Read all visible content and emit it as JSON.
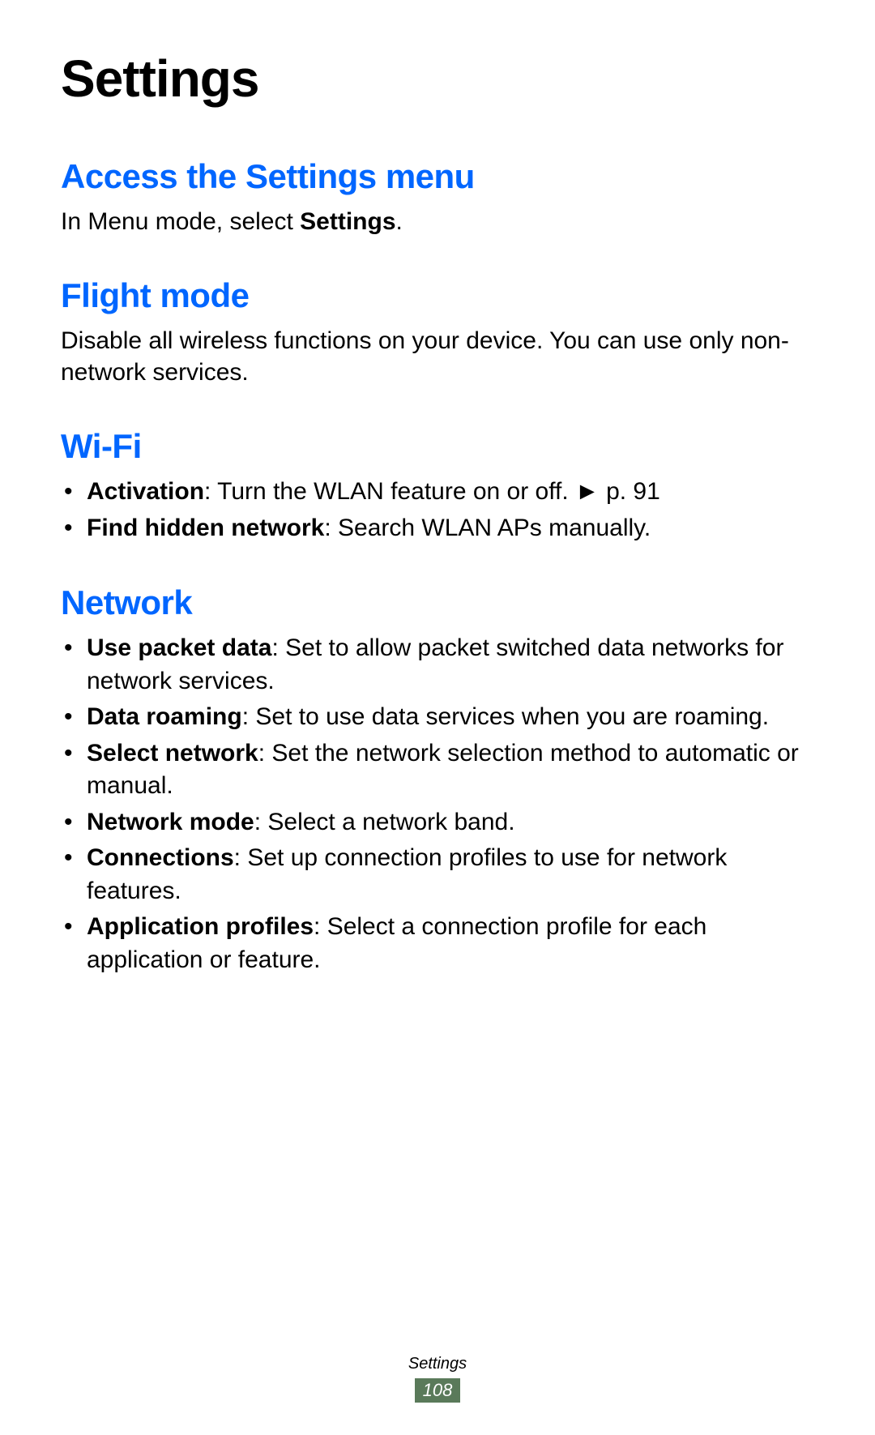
{
  "page_title": "Settings",
  "sections": {
    "access": {
      "heading": "Access the Settings menu",
      "body_prefix": "In Menu mode, select ",
      "body_bold": "Settings",
      "body_suffix": "."
    },
    "flight_mode": {
      "heading": "Flight mode",
      "body": "Disable all wireless functions on your device. You can use only non-network services."
    },
    "wifi": {
      "heading": "Wi-Fi",
      "items": [
        {
          "bold": "Activation",
          "text": ": Turn the WLAN feature on or off. ",
          "ref": "► p. 91"
        },
        {
          "bold": "Find hidden network",
          "text": ": Search WLAN APs manually.",
          "ref": ""
        }
      ]
    },
    "network": {
      "heading": "Network",
      "items": [
        {
          "bold": "Use packet data",
          "text": ": Set to allow packet switched data networks for network services."
        },
        {
          "bold": "Data roaming",
          "text": ": Set to use data services when you are roaming."
        },
        {
          "bold": "Select network",
          "text": ": Set the network selection method to automatic or manual."
        },
        {
          "bold": "Network mode",
          "text": ": Select a network band."
        },
        {
          "bold": "Connections",
          "text": ": Set up connection profiles to use for network features."
        },
        {
          "bold": "Application profiles",
          "text": ": Select a connection profile for each application or feature."
        }
      ]
    }
  },
  "footer": {
    "label": "Settings",
    "page_number": "108"
  }
}
